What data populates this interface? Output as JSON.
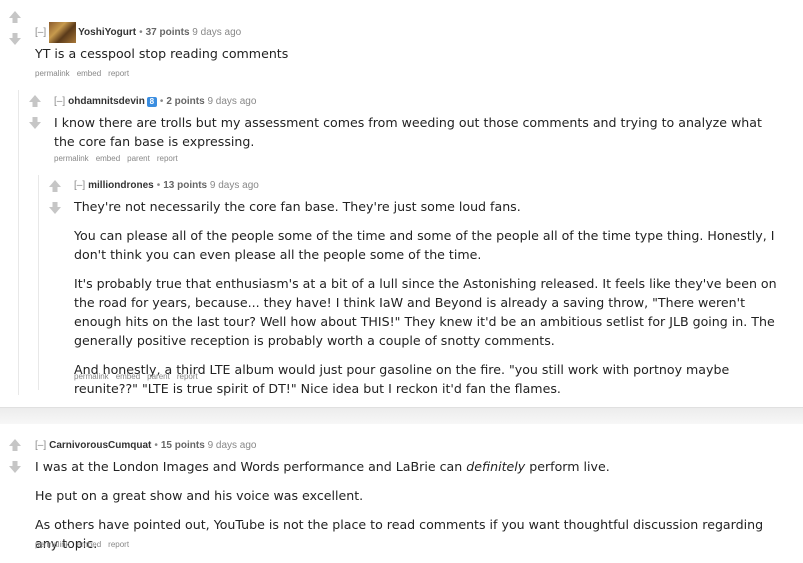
{
  "comments": [
    {
      "author": "YoshiYogurt",
      "collapse": "[–]",
      "score": "37 points",
      "age": "9 days ago",
      "paragraphs": [
        "YT is a cesspool stop reading comments"
      ],
      "actions": [
        "permalink",
        "embed",
        "report"
      ]
    },
    {
      "author": "ohdamnitsdevin",
      "collapse": "[–]",
      "badge": "8",
      "score": "2 points",
      "age": "9 days ago",
      "paragraphs": [
        "I know there are trolls but my assessment comes from weeding out those comments and trying to analyze what the core fan base is expressing."
      ],
      "actions": [
        "permalink",
        "embed",
        "parent",
        "report"
      ]
    },
    {
      "author": "milliondrones",
      "collapse": "[–]",
      "score": "13 points",
      "age": "9 days ago",
      "paragraphs": [
        "They're not necessarily the core fan base. They're just some loud fans.",
        "You can please all of the people some of the time and some of the people all of the time type thing. Honestly, I don't think you can even please all the people some of the time.",
        "It's probably true that enthusiasm's at a bit of a lull since the Astonishing released. It feels like they've been on the road for years, because... they have! I think IaW and Beyond is already a saving throw, \"There weren't enough hits on the last tour? Well how about THIS!\" They knew it'd be an ambitious setlist for JLB going in. The generally positive reception is probably worth a couple of snotty comments.",
        "And honestly, a third LTE album would just pour gasoline on the fire. \"you still work with portnoy maybe reunite??\" \"LTE is true spirit of DT!\" Nice idea but I reckon it'd fan the flames."
      ],
      "actions": [
        "permalink",
        "embed",
        "parent",
        "report"
      ]
    },
    {
      "author": "CarnivorousCumquat",
      "collapse": "[–]",
      "score": "15 points",
      "age": "9 days ago",
      "p1_before": "I was at the London Images and Words performance and LaBrie can ",
      "p1_em": "definitely",
      "p1_after": " perform live.",
      "paragraphs": [
        "He put on a great show and his voice was excellent.",
        "As others have pointed out, YouTube is not the place to read comments if you want thoughtful discussion regarding any topic."
      ],
      "actions": [
        "permalink",
        "embed",
        "report"
      ]
    }
  ],
  "colors": {
    "upvote": "#c6c6c6",
    "downvote": "#c6c6c6",
    "divider": "#ececec"
  }
}
